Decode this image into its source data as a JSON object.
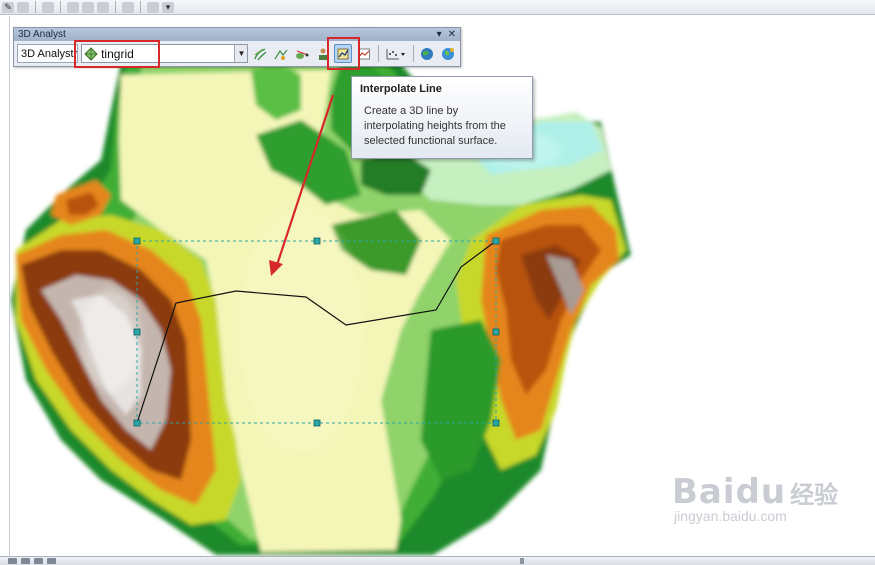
{
  "toolbar_window": {
    "title": "3D Analyst",
    "menu_label": "3D Analyst",
    "layer_value": "tingrid",
    "pin_glyph": "▾",
    "close_glyph": "✕",
    "buttons": [
      "contour-icon",
      "steepest-path-icon",
      "line-of-sight-icon",
      "observer-points-icon",
      "interpolate-line-icon",
      "profile-graph-icon",
      "point-tools-icon",
      "arcscene-icon",
      "arcglobe-icon"
    ],
    "active_button": "interpolate-line-icon"
  },
  "tooltip": {
    "title": "Interpolate Line",
    "line1": "Create a 3D line by",
    "line2": "interpolating heights from the",
    "line3": "selected functional surface."
  },
  "watermark": {
    "logo": "Baidu",
    "cn": "经验",
    "url": "jingyan.baidu.com"
  },
  "colors": {
    "annotation": "#d62828",
    "accent": "#5d8fc9",
    "terrain_low": "#f4f6b8",
    "terrain_green": "#2f9e2d",
    "terrain_orange": "#e5861a",
    "terrain_brown": "#8b3a0f",
    "terrain_peak": "#d9d9d9"
  }
}
